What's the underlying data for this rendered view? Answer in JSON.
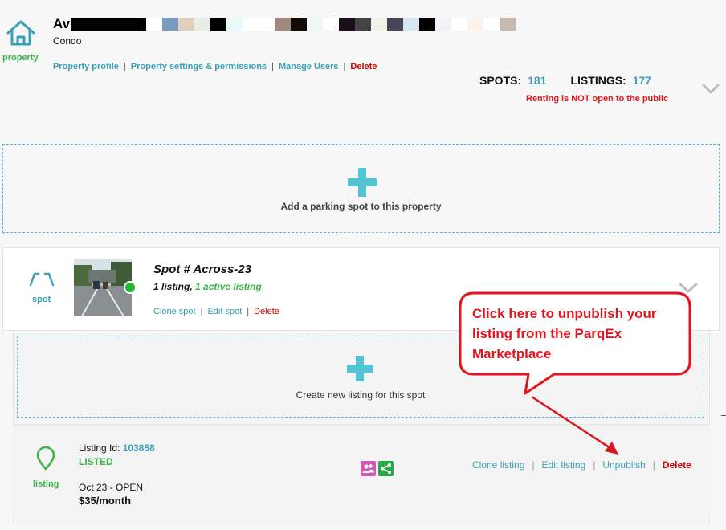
{
  "property": {
    "icon": "house-icon",
    "label": "property",
    "name_visible": "Av",
    "type": "Condo",
    "links": {
      "profile": "Property profile",
      "settings": "Property settings & permissions",
      "manage_users": "Manage Users",
      "delete": "Delete"
    },
    "stats": {
      "spots_label": "SPOTS:",
      "spots": "181",
      "listings_label": "LISTINGS:",
      "listings": "177"
    },
    "renting_status": "Renting is NOT open to the public"
  },
  "add_spot": {
    "label": "Add a parking spot to this property"
  },
  "spot": {
    "icon": "parking-spot-icon",
    "label": "spot",
    "title": "Spot # Across-23",
    "listing_count": "1 listing,",
    "active_count": "1 active listing",
    "links": {
      "clone": "Clone spot",
      "edit": "Edit spot",
      "delete": "Delete"
    }
  },
  "add_listing": {
    "label": "Create new listing for this spot"
  },
  "listing": {
    "icon": "location-pin-icon",
    "label": "listing",
    "id_label": "Listing Id:",
    "id": "103858",
    "status": "LISTED",
    "date": "Oct 23 - OPEN",
    "price": "$35/month",
    "actions": {
      "clone": "Clone listing",
      "edit": "Edit listing",
      "unpublish": "Unpublish",
      "delete": "Delete"
    }
  },
  "callout": {
    "text": "Click here to unpublish your listing from the ParqEx Marketplace"
  },
  "colors": {
    "accent": "#3aa0b5",
    "green": "#3cb34a",
    "danger": "#d40000",
    "callout": "#e3141e"
  }
}
